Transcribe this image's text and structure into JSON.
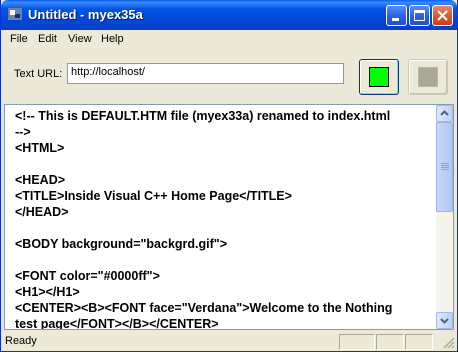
{
  "window": {
    "title": "Untitled - myex35a"
  },
  "menu": {
    "file": "File",
    "edit": "Edit",
    "view": "View",
    "help": "Help"
  },
  "toolbar": {
    "url_label": "Text URL:",
    "url_value": "http://localhost/",
    "go_button_color": "#00ff00",
    "stop_button_color": "#aca899"
  },
  "editor": {
    "text": "<!-- This is DEFAULT.HTM file (myex33a) renamed to index.html\n-->\n<HTML>\n\n<HEAD>\n<TITLE>Inside Visual C++ Home Page</TITLE>\n</HEAD>\n\n<BODY background=\"backgrd.gif\">\n\n<FONT color=\"#0000ff\">\n<H1></H1>\n<CENTER><B><FONT face=\"Verdana\">Welcome to the Nothing\ntest page</FONT></B></CENTER>"
  },
  "status": {
    "text": "Ready"
  }
}
